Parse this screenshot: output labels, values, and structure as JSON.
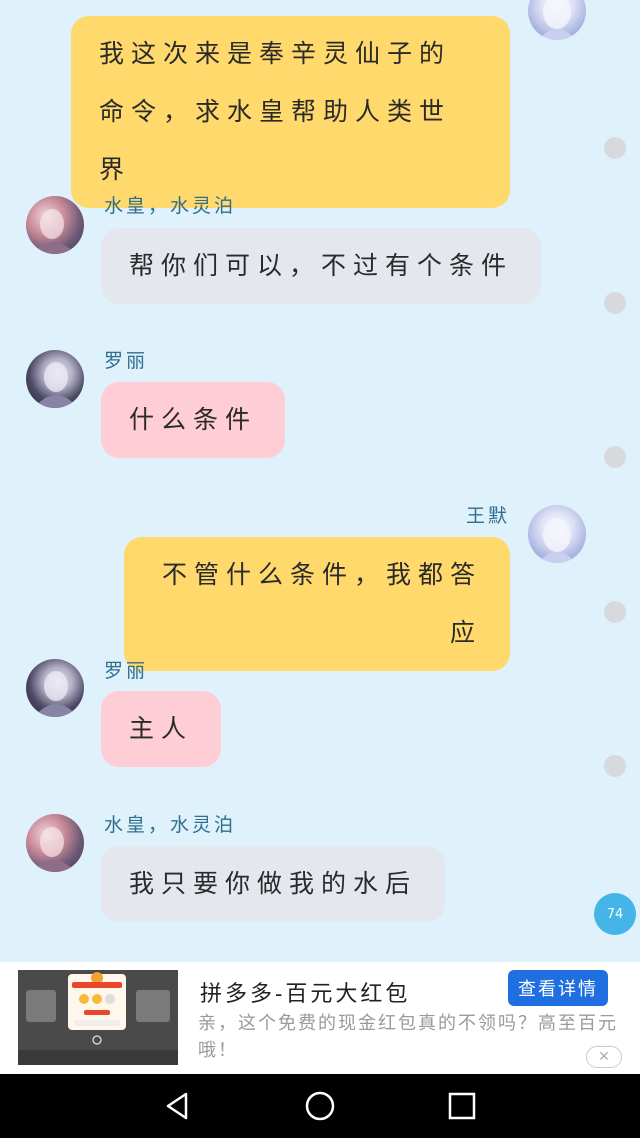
{
  "messages": [
    {
      "side": "right",
      "sender": "",
      "text": "我这次来是奉辛灵仙子的命令，求水皇帮助人类世界",
      "color": "#ffd96b"
    },
    {
      "side": "left",
      "sender": "水皇，水灵泊",
      "text": "帮你们可以，不过有个条件",
      "color": "#e4e7ee"
    },
    {
      "side": "left",
      "sender": "罗丽",
      "text": "什么条件",
      "color": "#ffcdd6"
    },
    {
      "side": "right",
      "sender": "王默",
      "text": "不管什么条件，我都答应",
      "color": "#ffd96b"
    },
    {
      "side": "left",
      "sender": "罗丽",
      "text": "主人",
      "color": "#ffcdd6"
    },
    {
      "side": "left",
      "sender": "水皇，水灵泊",
      "text": "我只要你做我的水后",
      "color": "#e4e7ee"
    }
  ],
  "unread_count": "74",
  "ad": {
    "title": "拼多多-百元大红包",
    "description": "亲，这个免费的现金红包真的不领吗？高至百元哦！",
    "button_label": "查看详情",
    "close_symbol": "✕",
    "button_color": "#1f6fe0"
  },
  "navbar": {
    "icons": [
      "back-icon",
      "home-icon",
      "recents-icon"
    ]
  }
}
